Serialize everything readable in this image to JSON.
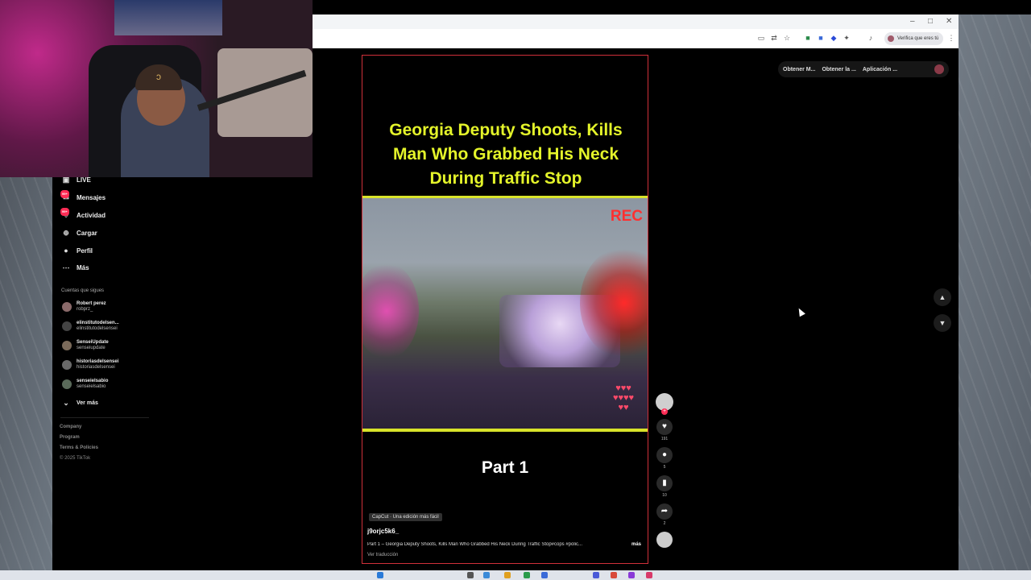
{
  "browser": {
    "profile_chip": "Verifica que eres tú"
  },
  "top_actions": [
    "Obtener M...",
    "Obtener la ...",
    "Aplicación ..."
  ],
  "sidebar": {
    "items": [
      {
        "label": "LIVE",
        "icon": "live-icon"
      },
      {
        "label": "Mensajes",
        "icon": "messages-icon",
        "badge": "99+"
      },
      {
        "label": "Actividad",
        "icon": "activity-icon",
        "badge": "99+"
      },
      {
        "label": "Cargar",
        "icon": "upload-icon"
      },
      {
        "label": "Perfil",
        "icon": "profile-icon"
      },
      {
        "label": "Más",
        "icon": "more-icon"
      }
    ],
    "following_title": "Cuentas que sigues",
    "following": [
      {
        "name": "Robert perez",
        "handle": "robprz_"
      },
      {
        "name": "elinstitutodelsen...",
        "handle": "elinstitutodelsensei"
      },
      {
        "name": "SenseiUpdate",
        "handle": "senseiupdate"
      },
      {
        "name": "historiasdelsensei",
        "handle": "historiasdelsensei"
      },
      {
        "name": "senseielsabio",
        "handle": "senseielsabio"
      }
    ],
    "see_more": "Ver más",
    "footer": [
      "Company",
      "Program",
      "Terms & Policies",
      "© 2025 TikTok"
    ]
  },
  "video": {
    "headline": "Georgia Deputy Shoots, Kills Man Who Grabbed His Neck During Traffic Stop",
    "rec_label": "REC",
    "part_label": "Part 1",
    "capcut_label": "CapCut · Una edición más fácil",
    "author": "j9orjc5k6_",
    "caption": "Part 1 – Georgia Deputy Shoots, Kills Man Who Grabbed His Neck During Traffic Stop#cops #polic...",
    "caption_more": "más",
    "translate": "Ver traducción"
  },
  "actions": {
    "likes": "191",
    "comments": "5",
    "saves": "10",
    "shares": "2"
  },
  "colors": {
    "headline": "#e4f42a",
    "accent": "#fe2c55",
    "video_border": "#d0303a"
  }
}
